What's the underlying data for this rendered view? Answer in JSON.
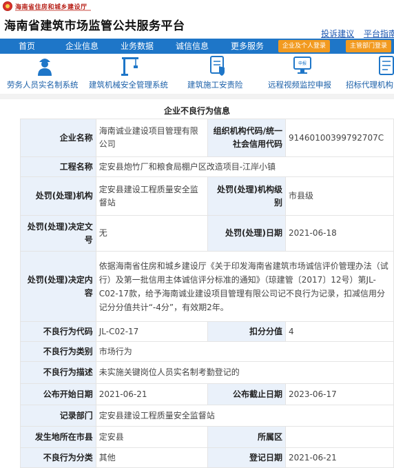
{
  "header": {
    "department": "海南省住房和城乡建设厅",
    "site_title": "海南省建筑市场监管公共服务平台",
    "links": [
      "投诉建议",
      "平台指南"
    ]
  },
  "nav": {
    "items": [
      "首页",
      "企业信息",
      "业务数据",
      "诚信信息",
      "更多服务"
    ],
    "login_enterprise": "企业及个人登录",
    "login_dept": "主管部门登录"
  },
  "services": [
    {
      "label": "劳务人员实名制系统",
      "icon": "worker-icon"
    },
    {
      "label": "建筑机械安全管理系统",
      "icon": "crane-icon"
    },
    {
      "label": "建筑施工安责险",
      "icon": "shield-document-icon"
    },
    {
      "label": "远程视频监控申报",
      "icon": "monitor-report-icon"
    },
    {
      "label": "招标代理机构",
      "icon": "document-icon"
    }
  ],
  "page": {
    "title": "企业不良行为信息"
  },
  "record": {
    "company_name_label": "企业名称",
    "company_name": "海南诚业建设项目管理有限公司",
    "credit_code_label": "组织机构代码/统一社会信用代码",
    "credit_code": "91460100399792707C",
    "project_label": "工程名称",
    "project": "定安县炮竹厂和粮食局棚户区改造项目-江岸小镇",
    "authority_label": "处罚(处理)机构",
    "authority": "定安县建设工程质量安全监督站",
    "authority_level_label": "处罚(处理)机构级别",
    "authority_level": "市县级",
    "doc_no_label": "处罚(处理)决定文号",
    "doc_no": "无",
    "decision_date_label": "处罚(处理)日期",
    "decision_date": "2021-06-18",
    "content_label": "处罚(处理)决定内容",
    "content": "依据海南省住房和城乡建设厅《关于印发海南省建筑市场诚信评价管理办法（试行）及第一批信用主体诚信评分标准的通知》（琼建管〔2017〕12号）第JL-C02-17款，给予海南诚业建设项目管理有限公司记不良行为记录，扣减信用分记分分值共计“-4分”，有效期2年。",
    "code_label": "不良行为代码",
    "code": "JL-C02-17",
    "score_label": "扣分分值",
    "score": "4",
    "category_label": "不良行为类别",
    "category": "市场行为",
    "description_label": "不良行为描述",
    "description": "未实施关键岗位人员实名制考勤登记的",
    "publish_start_label": "公布开始日期",
    "publish_start": "2021-06-21",
    "publish_end_label": "公布截止日期",
    "publish_end": "2023-06-17",
    "recorder_label": "记录部门",
    "recorder": "定安县建设工程质量安全监督站",
    "city_label": "发生地所在市县",
    "city": "定安县",
    "district_label": "所属区",
    "district": "",
    "classification_label": "不良行为分类",
    "classification": "其他",
    "register_date_label": "登记日期",
    "register_date": "2021-06-21"
  },
  "colors": {
    "nav": "#1e76c8",
    "accent_button": "#f29a1f",
    "label_bg": "#eaf1fa",
    "link": "#1a56b0"
  }
}
